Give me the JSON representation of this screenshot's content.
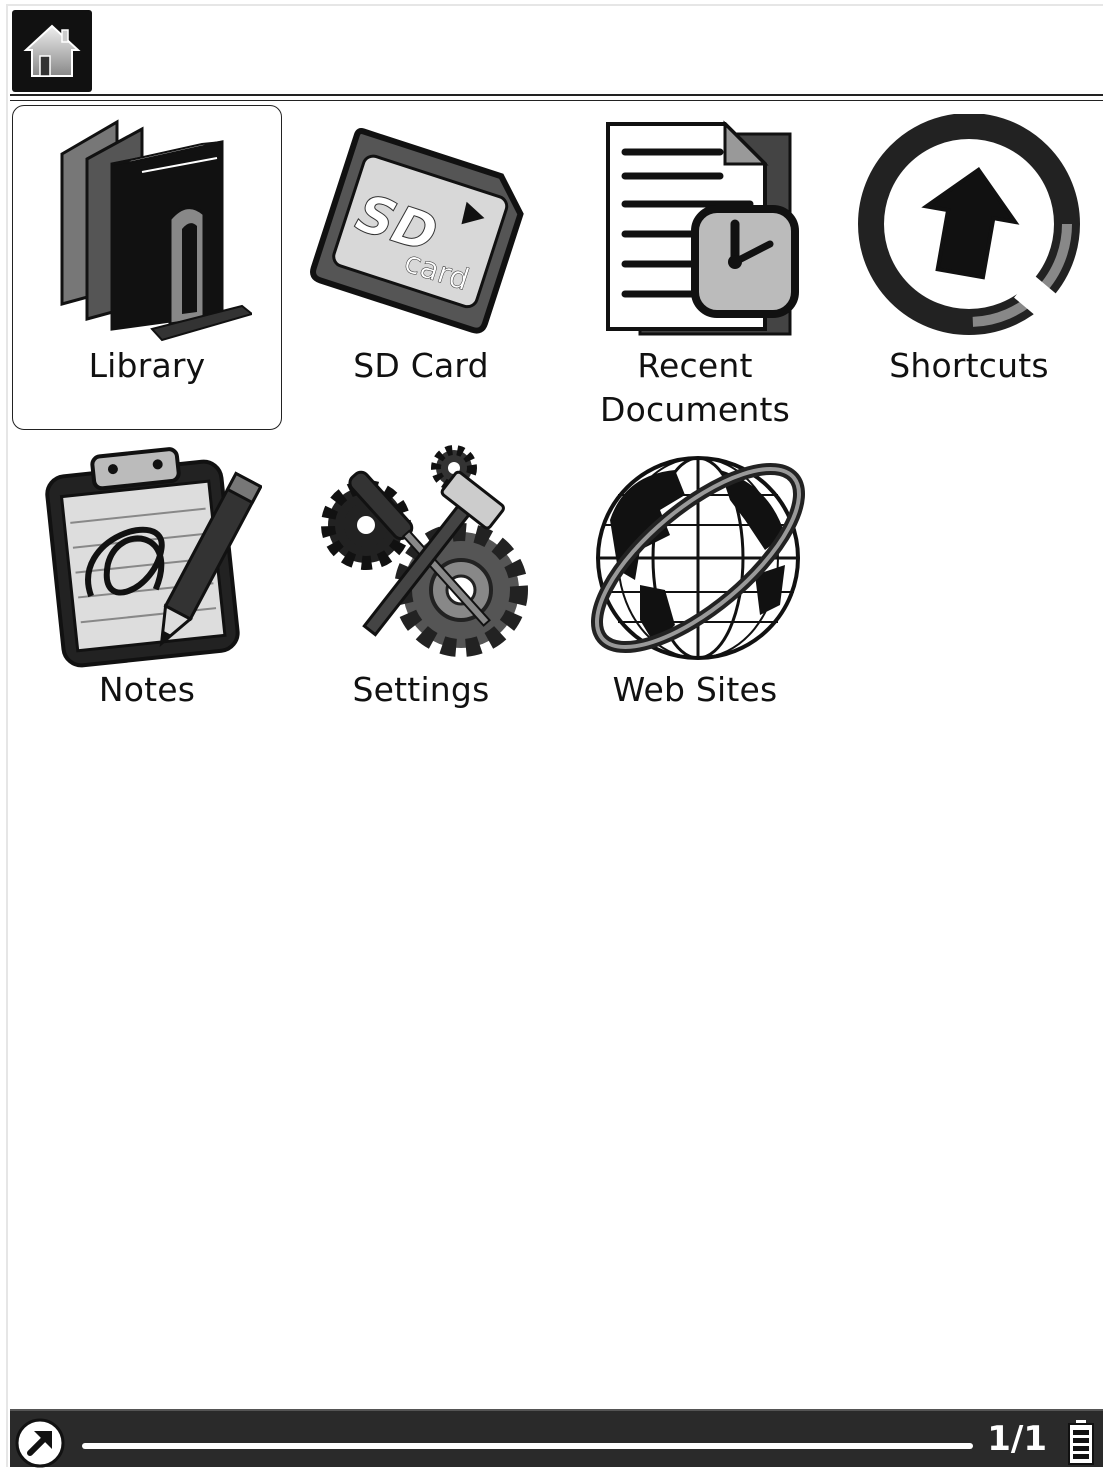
{
  "header": {
    "home_icon": "home-icon"
  },
  "tiles": [
    {
      "label": "Library",
      "icon": "library-books-icon",
      "selected": true
    },
    {
      "label": "SD Card",
      "icon": "sd-card-icon",
      "selected": false
    },
    {
      "label_line1": "Recent",
      "label_line2": "Documents",
      "icon": "recent-documents-icon",
      "selected": false
    },
    {
      "label": "Shortcuts",
      "icon": "shortcuts-arrow-icon",
      "selected": false
    },
    {
      "label": "Notes",
      "icon": "notes-clipboard-icon",
      "selected": false
    },
    {
      "label": "Settings",
      "icon": "settings-gears-icon",
      "selected": false
    },
    {
      "label": "Web Sites",
      "icon": "globe-icon",
      "selected": false
    }
  ],
  "status_bar": {
    "page_indicator": "1/1",
    "back_icon": "back-arrow-icon",
    "battery_icon": "battery-icon"
  }
}
